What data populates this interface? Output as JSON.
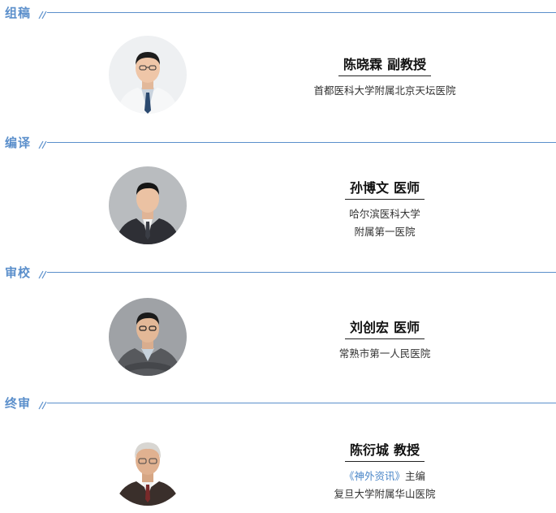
{
  "sections": [
    {
      "heading": "组稿",
      "name": "陈晓霖",
      "title": "副教授",
      "lines": [
        "首都医科大学附属北京天坛医院"
      ]
    },
    {
      "heading": "编译",
      "name": "孙博文",
      "title": "医师",
      "lines": [
        "哈尔滨医科大学",
        "附属第一医院"
      ]
    },
    {
      "heading": "审校",
      "name": "刘创宏",
      "title": "医师",
      "lines": [
        "常熟市第一人民医院"
      ]
    },
    {
      "heading": "终审",
      "name": "陈衍城",
      "title": "教授",
      "journal": "《神外资讯》",
      "journal_role": "主编",
      "lines": [
        "复旦大学附属华山医院"
      ]
    }
  ],
  "colors": {
    "accent": "#5b8fcb",
    "journal": "#4a86c8",
    "text": "#333333"
  }
}
